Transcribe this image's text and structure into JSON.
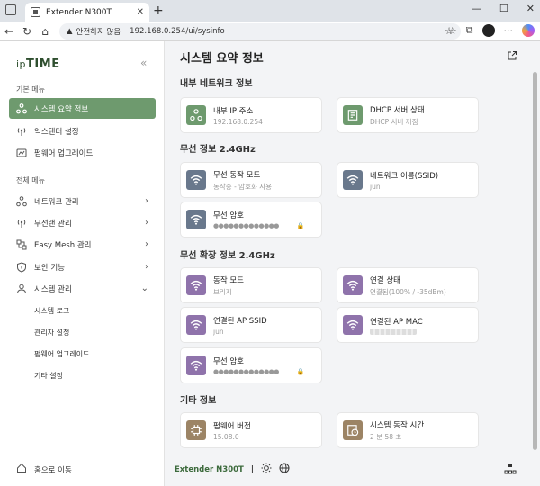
{
  "browser": {
    "tab_title": "Extender N300T",
    "tab_close": "✕",
    "new_tab": "+",
    "win_min": "—",
    "win_max": "☐",
    "win_close": "✕",
    "security_warning": "안전하지 않음",
    "url": "192.168.0.254/ui/sysinfo"
  },
  "sidebar": {
    "logo_ip": "ip",
    "logo_time": "TIME",
    "collapse": "«",
    "basic_label": "기본 메뉴",
    "basic_items": [
      {
        "label": "시스템 요약 정보"
      },
      {
        "label": "익스텐더 설정"
      },
      {
        "label": "펌웨어 업그레이드"
      }
    ],
    "all_label": "전체 메뉴",
    "all_items": [
      {
        "label": "네트워크 관리"
      },
      {
        "label": "무선랜 관리"
      },
      {
        "label": "Easy Mesh 관리"
      },
      {
        "label": "보안 기능"
      },
      {
        "label": "시스템 관리"
      }
    ],
    "sub_items": [
      {
        "label": "시스템 로그"
      },
      {
        "label": "관리자 설정"
      },
      {
        "label": "펌웨어 업그레이드"
      },
      {
        "label": "기타 설정"
      }
    ],
    "home": "홈으로 이동"
  },
  "main": {
    "title": "시스템 요약 정보",
    "groups": {
      "internal": "내부 네트워크 정보",
      "wireless": "무선 정보 2.4GHz",
      "extend": "무선 확장 정보 2.4GHz",
      "etc": "기타 정보"
    },
    "cards": {
      "ip": {
        "label": "내부 IP 주소",
        "value": "192.168.0.254"
      },
      "dhcp": {
        "label": "DHCP 서버 상태",
        "value": "DHCP 서버 꺼짐"
      },
      "wmode": {
        "label": "무선 동작 모드",
        "value": "동작중 - 암호화 사용"
      },
      "ssid": {
        "label": "네트워크 이름(SSID)",
        "value": "jun"
      },
      "wpwd": {
        "label": "무선 암호",
        "value": "●●●●●●●●●●●●●",
        "lock": "🔒"
      },
      "emode": {
        "label": "동작 모드",
        "value": "브리지"
      },
      "conn": {
        "label": "연결 상태",
        "value": "연결됨(100% / -35dBm)"
      },
      "apssid": {
        "label": "연결된 AP SSID",
        "value": "jun"
      },
      "apmac": {
        "label": "연결된 AP MAC"
      },
      "epwd": {
        "label": "무선 암호",
        "value": "●●●●●●●●●●●●●",
        "lock": "🔒"
      },
      "fw": {
        "label": "펌웨어 버전",
        "value": "15.08.0"
      },
      "uptime": {
        "label": "시스템 동작 시간",
        "value": "2 분 58 초"
      }
    }
  },
  "footer": {
    "model": "Extender N300T",
    "sep": "|"
  },
  "colors": {
    "green": "#6e9a6e",
    "slate": "#69788c",
    "purple": "#8f73ab",
    "brown": "#9c8465"
  }
}
